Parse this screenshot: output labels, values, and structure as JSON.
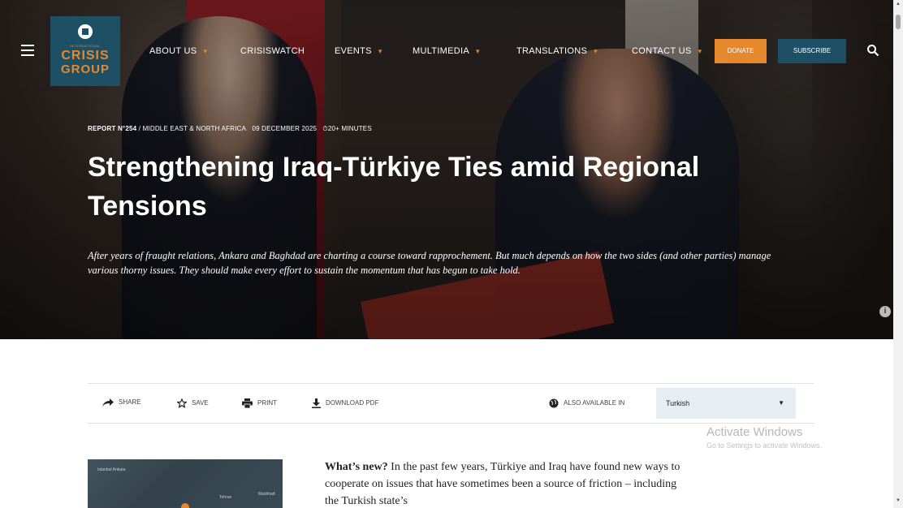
{
  "nav": {
    "logo": {
      "intl": "INTERNATIONAL",
      "line1": "CRISIS",
      "line2": "GROUP"
    },
    "items": [
      {
        "label": "ABOUT US",
        "has_caret": true
      },
      {
        "label": "CRISISWATCH",
        "has_caret": false
      },
      {
        "label": "EVENTS",
        "has_caret": true
      },
      {
        "label": "MULTIMEDIA",
        "has_caret": true
      },
      {
        "label": "TRANSLATIONS",
        "has_caret": true
      },
      {
        "label": "CONTACT US",
        "has_caret": true
      }
    ],
    "donate_label": "DONATE",
    "subscribe_label": "SUBSCRIBE",
    "caret_glyph": "▾"
  },
  "article": {
    "report_no": "REPORT N°254",
    "region": " / MIDDLE EAST & NORTH AFRICA",
    "date": "09 DECEMBER 2025",
    "read_time": "⏱20+ MINUTES",
    "title": "Strengthening Iraq-Türkiye Ties amid Regional Tensions",
    "dek": "After years of fraught relations, Ankara and Baghdad are charting a course toward rapprochement. But much depends on how the two sides (and other parties) manage various thorny issues. They should make every effort to sustain the momentum that has begun to take hold."
  },
  "toolbar": {
    "share": "SHARE",
    "save": "SAVE",
    "print": "PRINT",
    "download": "DOWNLOAD PDF",
    "also_available": "ALSO AVAILABLE IN",
    "language": "Turkish"
  },
  "watermark": {
    "line1": "Activate Windows",
    "line2": "Go to Settings to activate Windows."
  },
  "body": {
    "lead": "What’s new?",
    "text": " In the past few years, Türkiye and Iraq have found new ways to cooperate on issues that have sometimes been a source of friction – including the Turkish state’s"
  },
  "map": {
    "labels": [
      "Istanbul  Ankara",
      "Tehran",
      "Mashhad"
    ]
  },
  "colors": {
    "accent_orange": "#e8882d",
    "brand_teal": "#1d5065",
    "select_bg": "#e7eef3"
  }
}
